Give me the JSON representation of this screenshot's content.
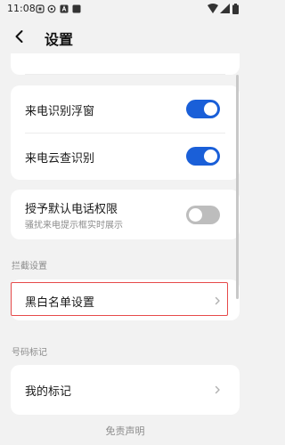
{
  "status_bar": {
    "time": "11:08",
    "left_icons": [
      "sim-card-icon",
      "settings-status-icon",
      "app-a-icon",
      "square-notification-icon"
    ],
    "right_icons": [
      "wifi-icon",
      "cellular-signal-icon",
      "battery-icon"
    ]
  },
  "header": {
    "back_icon": "chevron-left-icon",
    "title": "设置"
  },
  "settings": {
    "incoming_float": {
      "label": "来电识别浮窗",
      "enabled": true
    },
    "cloud_lookup": {
      "label": "来电云查识别",
      "enabled": true
    },
    "default_phone": {
      "label": "授予默认电话权限",
      "subtitle": "骚扰来电提示框实时展示",
      "enabled": false
    }
  },
  "sections": {
    "block_settings": {
      "header": "拦截设置",
      "items": [
        {
          "label": "黑白名单设置"
        }
      ]
    },
    "number_marks": {
      "header": "号码标记",
      "items": [
        {
          "label": "我的标记"
        }
      ]
    }
  },
  "footer": {
    "disclaimer": "免责声明"
  },
  "colors": {
    "accent": "#1a5fd8",
    "toggle_off": "#bdbdbd",
    "highlight": "#e64a4a",
    "background": "#f2f2f2"
  }
}
